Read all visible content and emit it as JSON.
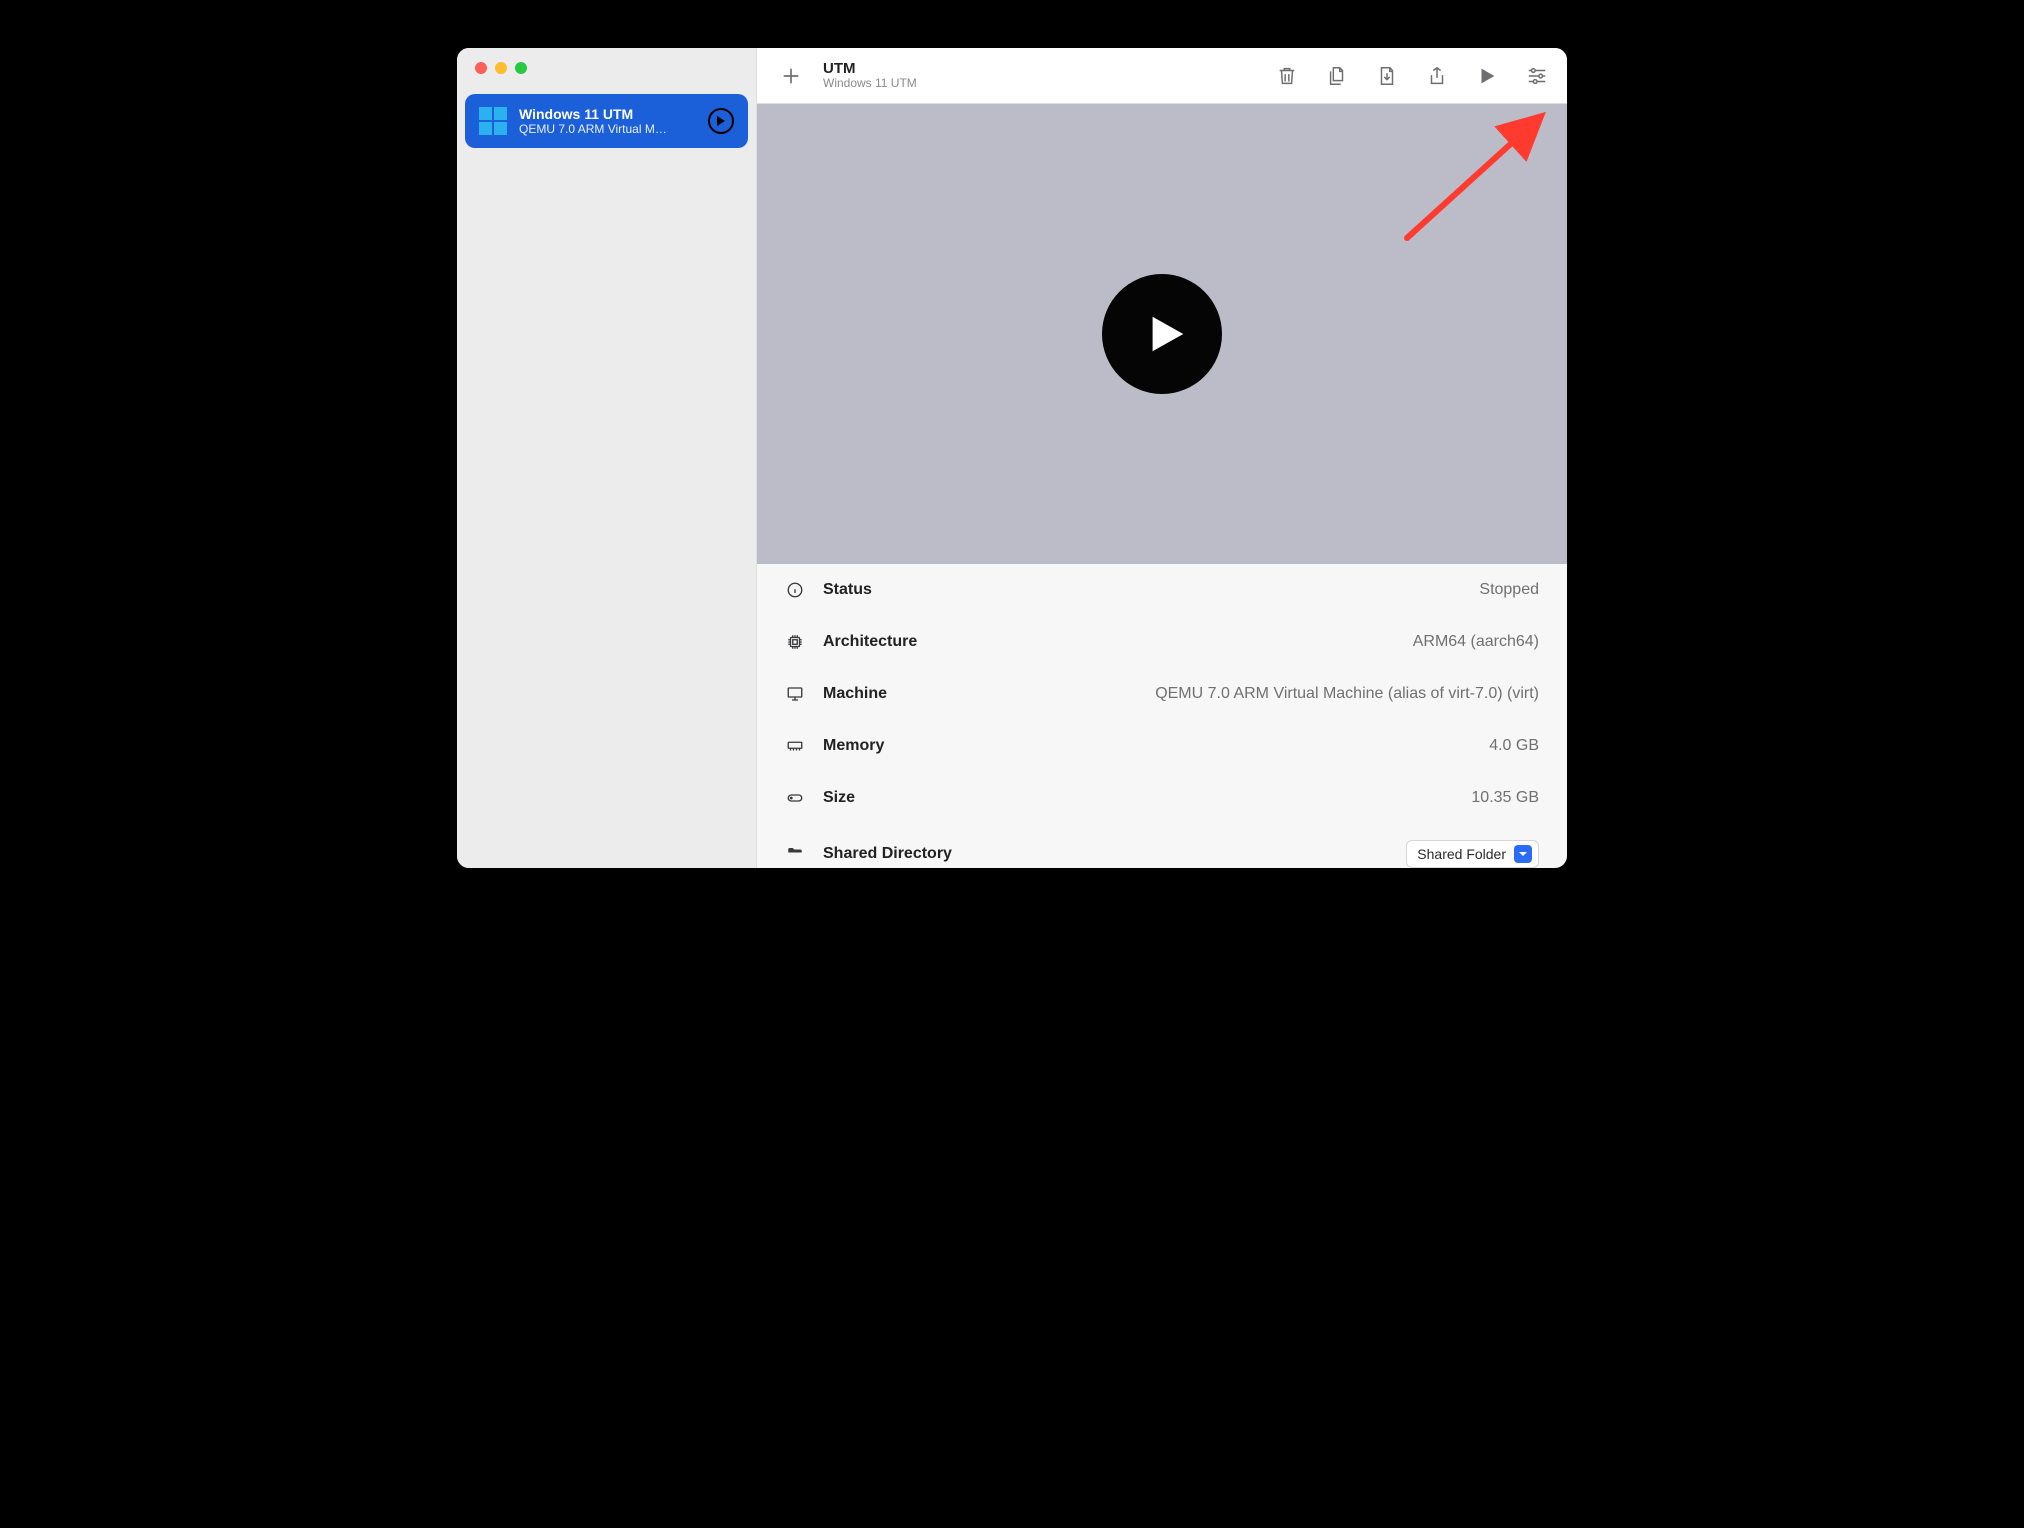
{
  "app": {
    "title": "UTM",
    "subtitle": "Windows 11 UTM"
  },
  "sidebar": {
    "vm": {
      "name": "Windows 11 UTM",
      "subtitle": "QEMU 7.0 ARM Virtual M…"
    }
  },
  "details": {
    "status": {
      "label": "Status",
      "value": "Stopped"
    },
    "arch": {
      "label": "Architecture",
      "value": "ARM64 (aarch64)"
    },
    "machine": {
      "label": "Machine",
      "value": "QEMU 7.0 ARM Virtual Machine (alias of virt-7.0) (virt)"
    },
    "memory": {
      "label": "Memory",
      "value": "4.0 GB"
    },
    "size": {
      "label": "Size",
      "value": "10.35 GB"
    },
    "shared": {
      "label": "Shared Directory",
      "button": "Shared Folder"
    }
  }
}
